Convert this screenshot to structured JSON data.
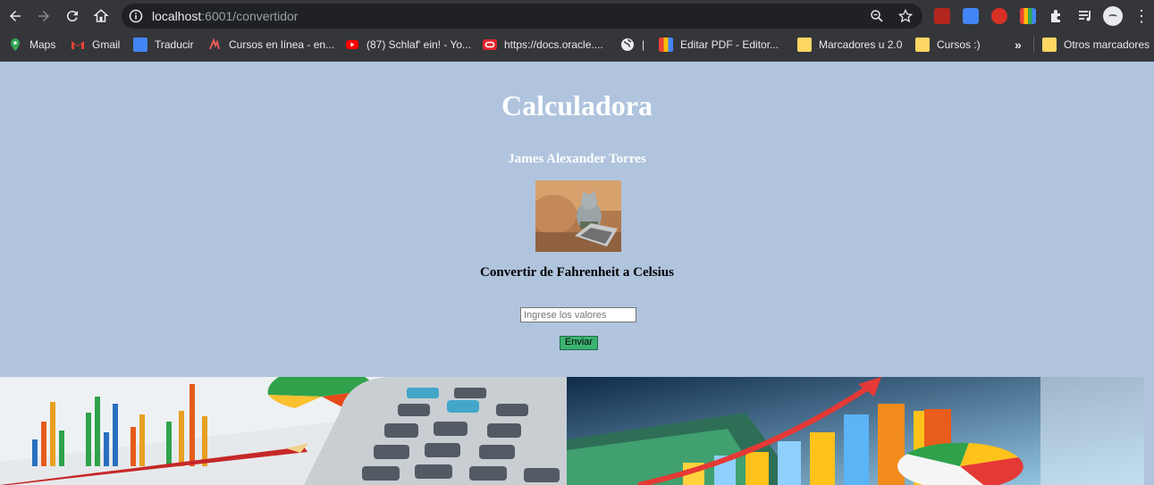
{
  "browser": {
    "url_host": "localhost",
    "url_rest": ":6001/convertidor",
    "bookmarks": [
      {
        "label": "Maps",
        "icon": "maps-icon"
      },
      {
        "label": "Gmail",
        "icon": "gmail-icon"
      },
      {
        "label": "Traducir",
        "icon": "translate-icon"
      },
      {
        "label": "Cursos en línea - en...",
        "icon": "courses-icon"
      },
      {
        "label": "(87) Schlaf' ein! - Yo...",
        "icon": "youtube-icon"
      },
      {
        "label": "https://docs.oracle....",
        "icon": "oracle-icon"
      },
      {
        "label": "|",
        "icon": "globe-icon"
      },
      {
        "label": "Editar PDF - Editor...",
        "icon": "pdf-editor-icon"
      },
      {
        "label": "Marcadores u 2.0",
        "icon": "folder-icon"
      },
      {
        "label": "Cursos :)",
        "icon": "folder-icon"
      }
    ],
    "more_bookmarks": "»",
    "other_bookmarks": "Otros marcadores"
  },
  "page": {
    "title": "Calculadora",
    "author": "James Alexander Torres",
    "subtitle": "Convertir de Fahrenheit a Celsius",
    "input_placeholder": "Ingrese los valores",
    "submit_label": "Enviar"
  },
  "colors": {
    "page_background": "#b0c4de",
    "submit_button": "#3cb371",
    "chrome_dark": "#35363a"
  }
}
